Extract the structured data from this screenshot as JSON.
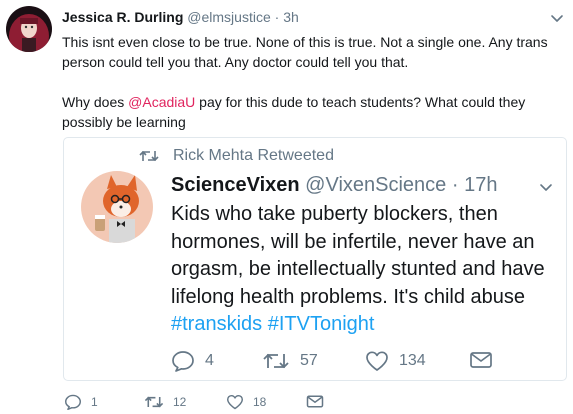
{
  "tweet": {
    "display_name": "Jessica R. Durling",
    "handle": "@elmsjustice",
    "separator": "·",
    "time": "3h",
    "text_line1": "This isnt even close to be true. None of this is true. Not a single one. Any trans person could tell you that. Any doctor could tell you that.",
    "text_p2_before": "Why does ",
    "mention": "@AcadiaU",
    "text_p2_after": " pay for this dude to teach students? What could they possibly be learning",
    "actions": {
      "reply_count": "1",
      "retweet_count": "12",
      "like_count": "18"
    }
  },
  "quoted": {
    "retweeted_by": "Rick Mehta Retweeted",
    "display_name": "ScienceVixen",
    "handle": "@VixenScience",
    "separator": "·",
    "time": "17h",
    "text_main": "Kids who take puberty blockers, then hormones, will be infertile, never have an orgasm, be intellectually stunted and have lifelong health problems. It's child abuse ",
    "hashtag1": "#transkids",
    "hashtag2": "#ITVTonight",
    "actions": {
      "reply_count": "4",
      "retweet_count": "57",
      "like_count": "134"
    }
  },
  "colors": {
    "text": "#14171a",
    "secondary": "#657786",
    "mention": "#e0245e",
    "hashtag": "#1da1f2",
    "border": "#e1e8ed"
  },
  "icons": [
    "chevron-down-icon",
    "retweet-icon",
    "reply-icon",
    "heart-icon",
    "direct-message-icon"
  ]
}
